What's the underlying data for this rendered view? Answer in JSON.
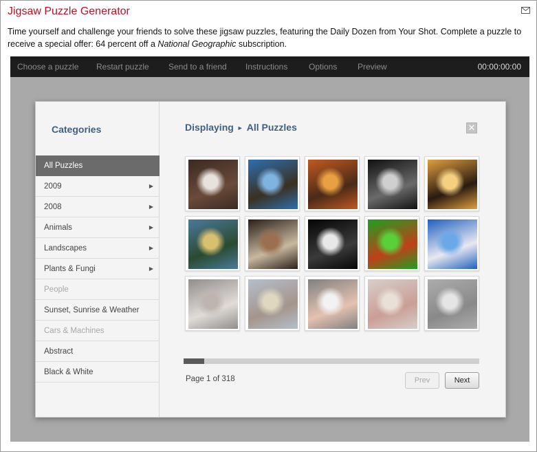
{
  "header": {
    "title": "Jigsaw Puzzle Generator",
    "mail_icon": "envelope-icon",
    "description_before": "Time yourself and challenge your friends to solve these jigsaw puzzles, featuring the Daily Dozen from Your Shot. Complete a puzzle to receive a special offer: 64 percent off a ",
    "description_italic": "National Geographic",
    "description_after": " subscription."
  },
  "toolbar": {
    "items": [
      "Choose a puzzle",
      "Restart puzzle",
      "Send to a friend",
      "Instructions",
      "Options",
      "Preview"
    ],
    "timer": "00:00:00:00"
  },
  "categories": {
    "title": "Categories",
    "items": [
      {
        "label": "All Puzzles",
        "state": "active",
        "arrow": false
      },
      {
        "label": "2009",
        "state": "normal",
        "arrow": true
      },
      {
        "label": "2008",
        "state": "normal",
        "arrow": true
      },
      {
        "label": "Animals",
        "state": "normal",
        "arrow": true
      },
      {
        "label": "Landscapes",
        "state": "normal",
        "arrow": true
      },
      {
        "label": "Plants & Fungi",
        "state": "normal",
        "arrow": true
      },
      {
        "label": "People",
        "state": "disabled",
        "arrow": false
      },
      {
        "label": "Sunset, Sunrise & Weather",
        "state": "normal",
        "arrow": false
      },
      {
        "label": "Cars & Machines",
        "state": "disabled",
        "arrow": false
      },
      {
        "label": "Abstract",
        "state": "normal",
        "arrow": false
      },
      {
        "label": "Black & White",
        "state": "normal",
        "arrow": false
      }
    ]
  },
  "display": {
    "label": "Displaying",
    "separator": "►",
    "current": "All Puzzles",
    "close_icon": "close-icon",
    "close_glyph": "✕"
  },
  "thumbnails": [
    {
      "subject": "woman-white-dress",
      "colors": [
        "#3a2a22",
        "#e8e2dc",
        "#6a4a3a"
      ]
    },
    {
      "subject": "boy-blue-sky",
      "colors": [
        "#2e6fb0",
        "#7fb4e0",
        "#3a3020"
      ]
    },
    {
      "subject": "stained-glass",
      "colors": [
        "#c05a20",
        "#e8a040",
        "#4a2a18"
      ]
    },
    {
      "subject": "splash-bw",
      "colors": [
        "#111111",
        "#cfcfcf",
        "#6a6a6a"
      ]
    },
    {
      "subject": "jumping-silhouette",
      "colors": [
        "#e0a040",
        "#f5d080",
        "#2a1a10"
      ]
    },
    {
      "subject": "fishing-net",
      "colors": [
        "#4a7a9a",
        "#d8c070",
        "#2a4a30"
      ]
    },
    {
      "subject": "workers-dark",
      "colors": [
        "#2a2018",
        "#9a7050",
        "#c8b8a0"
      ]
    },
    {
      "subject": "white-egret",
      "colors": [
        "#050505",
        "#e8e8e8",
        "#3a3a3a"
      ]
    },
    {
      "subject": "swimmer-green",
      "colors": [
        "#1ea020",
        "#58d038",
        "#c0401a"
      ]
    },
    {
      "subject": "skydiver-blue",
      "colors": [
        "#2060c0",
        "#6aa8e8",
        "#e8e8f0"
      ]
    },
    {
      "subject": "crowd-street",
      "colors": [
        "#3a3230",
        "#8a7a70",
        "#c8c0b8"
      ]
    },
    {
      "subject": "horses-men",
      "colors": [
        "#7a8aa0",
        "#c8b890",
        "#5a4030"
      ]
    },
    {
      "subject": "girl-flowers",
      "colors": [
        "#1a1a1a",
        "#e8e8e8",
        "#d09070"
      ]
    },
    {
      "subject": "beach-crowd",
      "colors": [
        "#b8a8a0",
        "#d8c8b8",
        "#a05040"
      ]
    },
    {
      "subject": "market-bw",
      "colors": [
        "#6a6a6a",
        "#d0d0d0",
        "#2a2a2a"
      ]
    }
  ],
  "pagination": {
    "progress_fraction": 0.07,
    "page_label": "Page 1 of 318",
    "prev_label": "Prev",
    "next_label": "Next"
  }
}
